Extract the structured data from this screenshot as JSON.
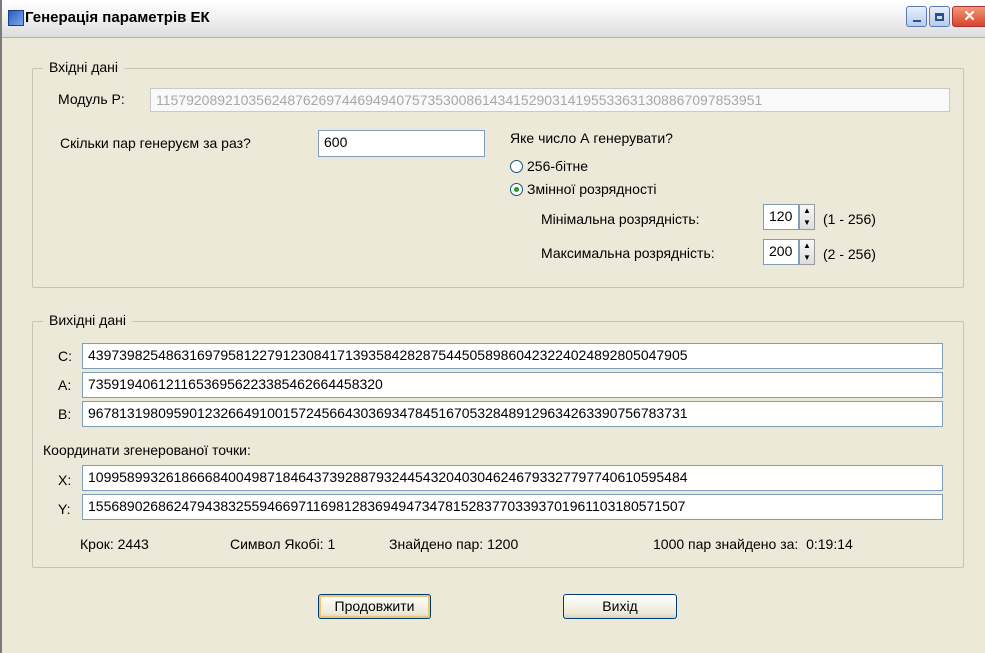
{
  "window": {
    "title": "Генерація параметрів ЕК"
  },
  "input_group": {
    "legend": "Вхідні дані",
    "modulus_label": "Модуль P:",
    "modulus_value": "115792089210356248762697446949407573530086143415290314195533631308867097853951",
    "pairs_label": "Скільки пар генеруєм за раз?",
    "pairs_value": "600",
    "a_question": "Яке число А генерувати?",
    "option_256": "256-бітне",
    "option_variable": "Змінної розрядності",
    "selected_option": "Змінної розрядності",
    "min_label": "Мінімальна розрядність:",
    "min_value": "120",
    "min_range": "(1 - 256)",
    "max_label": "Максимальна розрядність:",
    "max_value": "200",
    "max_range": "(2 - 256)"
  },
  "output_group": {
    "legend": "Вихідні дані",
    "c_label": "C:",
    "c_value": "43973982548631697958122791230841713935842828754450589860423224024892805047905",
    "a_label": "A:",
    "a_value": "735919406121165369562233854626644583​20",
    "b_label": "B:",
    "b_value": "96781319809590123266491001572456643036934784516705328489129634263390756783731",
    "coords_heading": "Координати згенерованої точки:",
    "x_label": "X:",
    "x_value": "10995899326186668400498718464373928879324454320403046246793327797740610595484",
    "y_label": "Y:",
    "y_value": "15568902686247943832559466971169812836949473478152837703393701961103180571507",
    "step_text": "Крок: 2443",
    "jacobi_text": "Символ Якобі: 1",
    "found_text": "Знайдено пар: 1200",
    "time_text": "1000 пар знайдено за:  0:19:14"
  },
  "buttons": {
    "continue": "Продовжити",
    "exit": "Вихід"
  }
}
